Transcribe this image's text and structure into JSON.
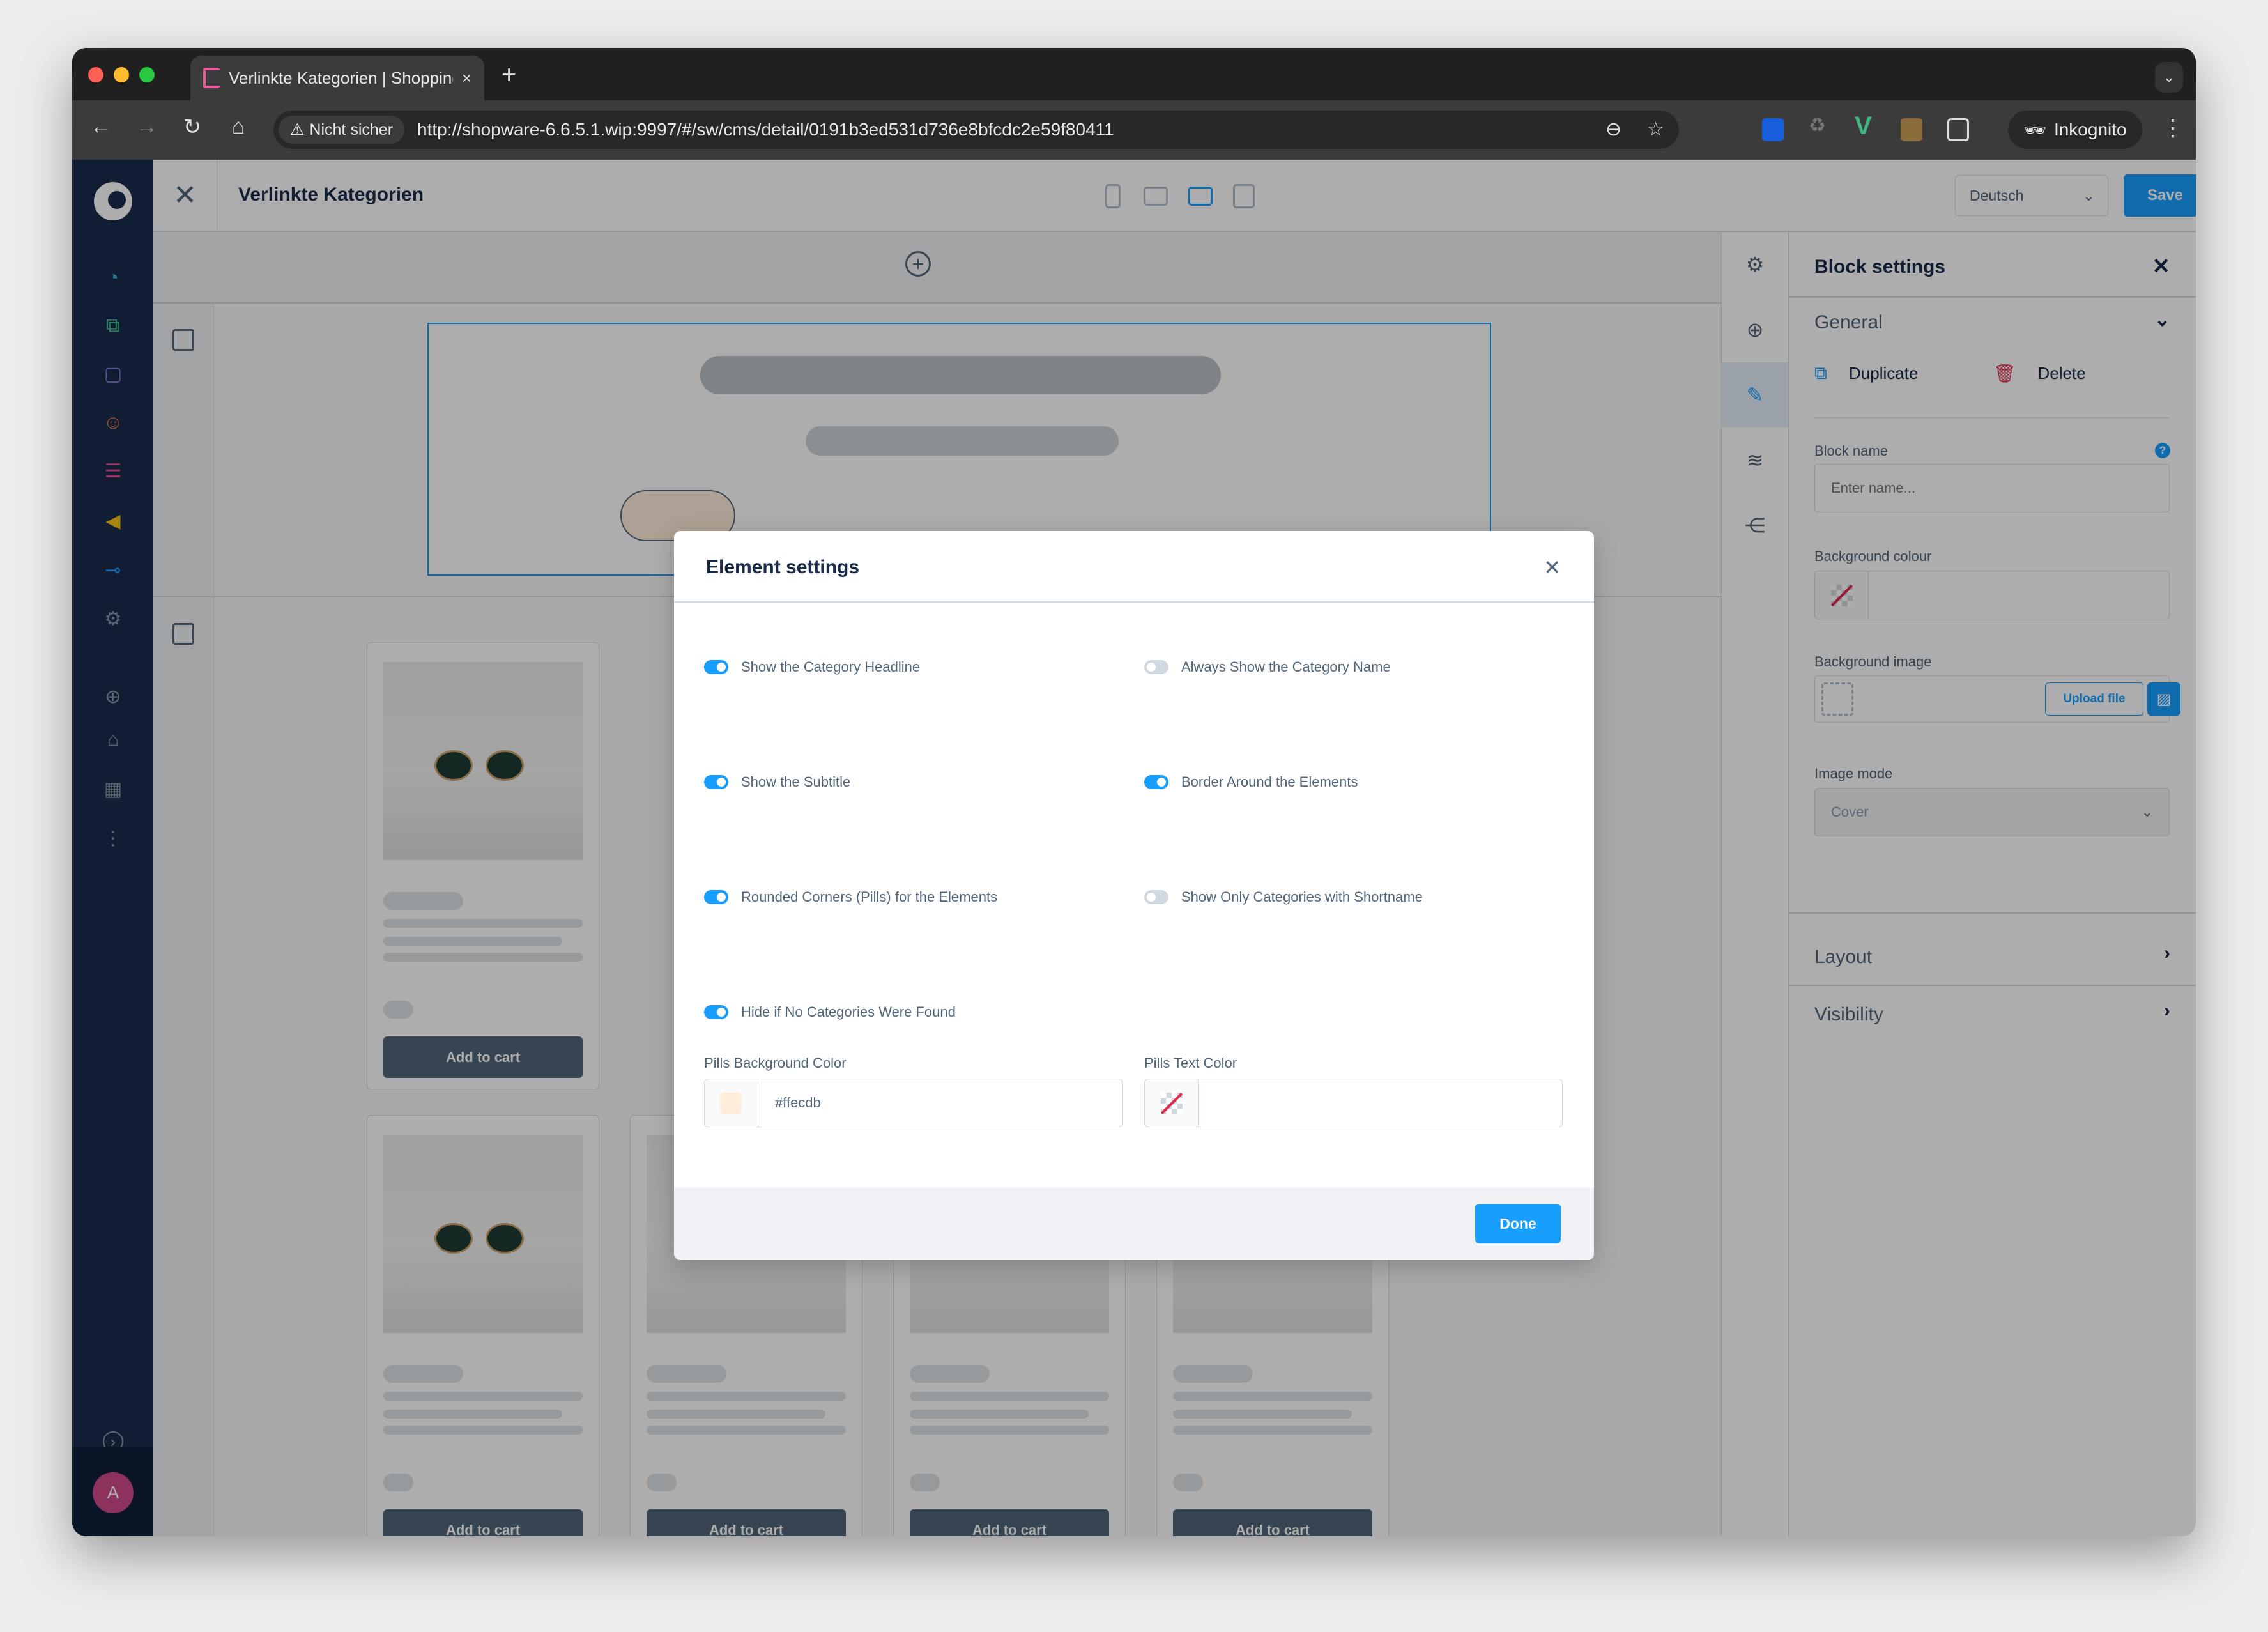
{
  "browser": {
    "tab_title": "Verlinkte Kategorien | Shopping",
    "tab_close": "×",
    "new_tab": "+",
    "security_chip": "Nicht sicher",
    "url": "http://shopware-6.6.5.1.wip:9997/#/sw/cms/detail/0191b3ed531d736e8bfcdc2e59f80411",
    "profile_label": "Inkognito",
    "icons": {
      "back": "←",
      "forward": "→",
      "reload": "↻",
      "home": "⌂",
      "warning": "⚠",
      "zoom": "⊖",
      "bookmark": "☆",
      "menu": "⋮",
      "tab_list": "⌄"
    }
  },
  "header": {
    "close_icon": "✕",
    "title": "Verlinkte Kategorien",
    "language": "Deutsch",
    "save_label": "Save",
    "chevron": "⌄"
  },
  "sidebar": {
    "items": [
      {
        "name": "dashboard",
        "glyph": "◔",
        "color": "#3fb8d8"
      },
      {
        "name": "catalogues",
        "glyph": "⧉",
        "color": "#37c78c"
      },
      {
        "name": "orders",
        "glyph": "▢",
        "color": "#8b7ce6"
      },
      {
        "name": "customers",
        "glyph": "☺",
        "color": "#f0794c"
      },
      {
        "name": "content",
        "glyph": "☰",
        "color": "#ea4c96"
      },
      {
        "name": "marketing",
        "glyph": "◀",
        "color": "#f5c419"
      },
      {
        "name": "extensions",
        "glyph": "⊸",
        "color": "#189eff"
      },
      {
        "name": "settings",
        "glyph": "⚙",
        "color": "#8a99aa"
      },
      {
        "name": "add-sales-channel",
        "glyph": "⊕",
        "color": "#8a99aa"
      },
      {
        "name": "storefront",
        "glyph": "⌂",
        "color": "#8a99aa"
      },
      {
        "name": "shop",
        "glyph": "▦",
        "color": "#8a99aa"
      },
      {
        "name": "more",
        "glyph": "⋮",
        "color": "#8a99aa"
      }
    ],
    "collapse_glyph": "›",
    "avatar_initial": "A"
  },
  "canvas": {
    "add_section": "+",
    "cards": [
      {
        "cart_label": "Add to cart"
      },
      {
        "cart_label": "Add to cart"
      },
      {
        "cart_label": "Add to cart"
      },
      {
        "cart_label": "Add to cart"
      },
      {
        "cart_label": "Add to cart"
      }
    ]
  },
  "iconbar": {
    "items": [
      {
        "name": "settings",
        "glyph": "⚙"
      },
      {
        "name": "add-block",
        "glyph": "⊕"
      },
      {
        "name": "edit-block",
        "glyph": "✎"
      },
      {
        "name": "layers",
        "glyph": "≋"
      },
      {
        "name": "share",
        "glyph": "⋲"
      }
    ]
  },
  "panel": {
    "title": "Block settings",
    "close": "✕",
    "general": "General",
    "duplicate": "Duplicate",
    "delete": "Delete",
    "block_name_label": "Block name",
    "block_name_placeholder": "Enter name...",
    "help": "?",
    "bg_colour_label": "Background colour",
    "bg_image_label": "Background image",
    "upload_label": "Upload file",
    "image_mode_label": "Image mode",
    "image_mode_value": "Cover",
    "layout": "Layout",
    "visibility": "Visibility",
    "chev_down": "⌄",
    "chev_right": "›"
  },
  "modal": {
    "title": "Element settings",
    "close": "✕",
    "options": [
      {
        "label": "Show the Category Headline",
        "on": true
      },
      {
        "label": "Always Show the Category Name",
        "on": false
      },
      {
        "label": "Show the Subtitle",
        "on": true
      },
      {
        "label": "Border Around the Elements",
        "on": true
      },
      {
        "label": "Rounded Corners (Pills) for the Elements",
        "on": true
      },
      {
        "label": "Show Only Categories with Shortname",
        "on": false
      },
      {
        "label": "Hide if No Categories Were Found",
        "on": true
      }
    ],
    "pills_bg_label": "Pills Background Color",
    "pills_bg_value": "#ffecdb",
    "pills_text_label": "Pills Text Color",
    "pills_text_value": "",
    "done_label": "Done"
  },
  "colors": {
    "accent": "#189eff",
    "sidebar_bg": "#1a2b4a",
    "delete_red": "#de294c",
    "avatar": "#d04b88",
    "pills_bg": "#ffecdb"
  }
}
